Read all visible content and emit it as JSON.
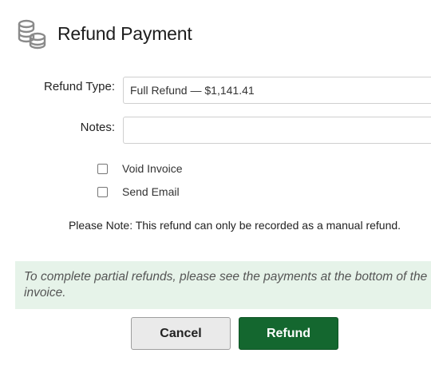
{
  "header": {
    "icon": "coins-icon",
    "title": "Refund Payment"
  },
  "form": {
    "refund_type_label": "Refund Type:",
    "refund_type_value": "Full Refund — $1,141.41",
    "notes_label": "Notes:",
    "notes_value": "",
    "void_invoice_label": "Void Invoice",
    "void_invoice_checked": false,
    "send_email_label": "Send Email",
    "send_email_checked": false
  },
  "note": "Please Note: This refund can only be recorded as a manual refund.",
  "info": "To complete partial refunds, please see the payments at the bottom of the invoice.",
  "buttons": {
    "cancel": "Cancel",
    "refund": "Refund"
  },
  "colors": {
    "primary": "#14672f",
    "info_bg": "#e6f3e9"
  }
}
